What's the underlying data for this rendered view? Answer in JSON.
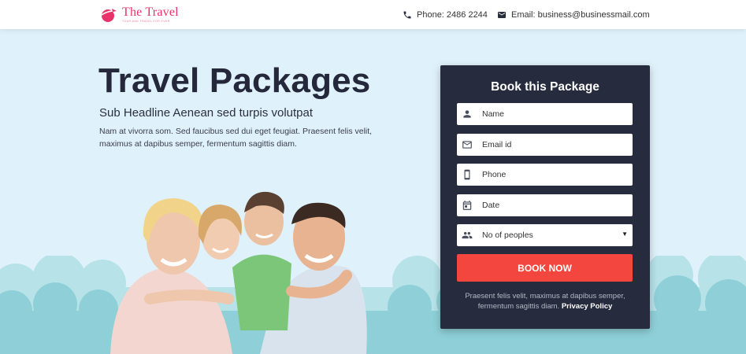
{
  "header": {
    "logo_name": "The Travel",
    "logo_tagline": "TOUR AND TRAVEL FOR EVER",
    "phone_label": "Phone: 2486 2244",
    "email_label": "Email: business@businessmail.com"
  },
  "hero": {
    "title": "Travel Packages",
    "subtitle": "Sub Headline Aenean sed turpis volutpat",
    "body": "Nam at vivorra som. Sed faucibus sed dui eget feugiat. Praesent felis velit, maximus at dapibus semper, fermentum sagittis diam."
  },
  "booking": {
    "title": "Book this Package",
    "name_placeholder": "Name",
    "email_placeholder": "Email id",
    "phone_placeholder": "Phone",
    "date_placeholder": "Date",
    "people_selected": "No of peoples",
    "button_label": "BOOK NOW",
    "note": "Praesent felis velit, maximus at dapibus semper, fermentum sagittis diam.",
    "privacy_link": "Privacy Policy"
  },
  "colors": {
    "brand_pink": "#e8326a",
    "panel_bg": "#262b3d",
    "button_red": "#f2463e",
    "page_bg": "#dff1fa",
    "cloud_teal": "#8fd0d8"
  },
  "icons": {
    "phone": "phone-icon",
    "email": "envelope-icon",
    "name": "person-icon",
    "mail": "mail-icon",
    "mobile": "smartphone-icon",
    "date": "calendar-icon",
    "people": "group-icon"
  }
}
